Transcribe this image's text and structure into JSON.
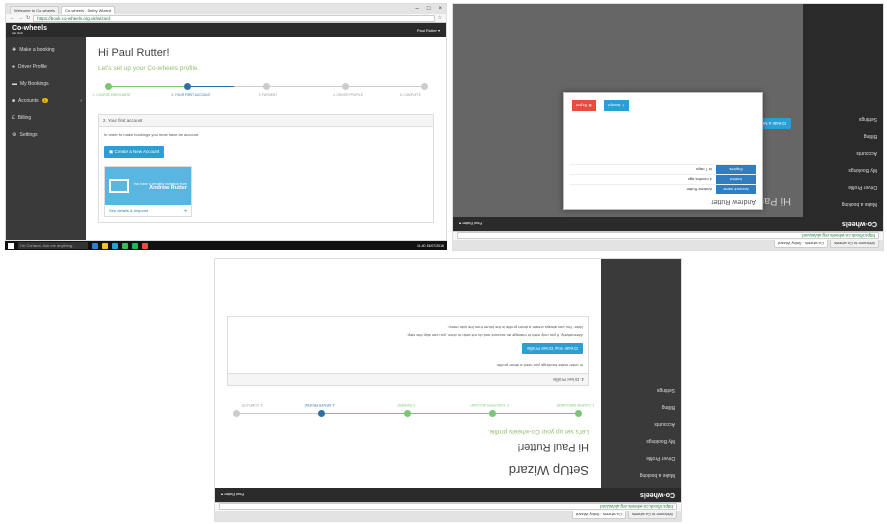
{
  "browser": {
    "tabs": [
      "Welcome to Co-wheels",
      "Co-wheels - Selby Wizard"
    ],
    "url": "https://book.co-wheels.org.uk/wizard",
    "window_controls": [
      "–",
      "□",
      "×"
    ]
  },
  "app": {
    "logo": "Co-wheels",
    "logo_sub": "car club",
    "user_menu": "Paul Rutter ▾"
  },
  "sidebar": {
    "items": [
      {
        "label": "Make a booking",
        "icon": "plus-icon"
      },
      {
        "label": "Driver Profile",
        "icon": "user-icon"
      },
      {
        "label": "My Bookings",
        "icon": "car-icon"
      },
      {
        "label": "Accounts",
        "icon": "briefcase-icon",
        "badge": "1"
      },
      {
        "label": "Billing",
        "icon": "pound-icon"
      },
      {
        "label": "Settings",
        "icon": "gear-icon"
      }
    ]
  },
  "wizard": {
    "heading": "Hi Paul Rutter!",
    "subheading": "Let's set up your Co-wheels profile.",
    "steps": [
      {
        "label": "1. COURSE ENROLMENT",
        "state": "done"
      },
      {
        "label": "2. YOUR FIRST ACCOUNT",
        "state": "active"
      },
      {
        "label": "3. PAYMENT",
        "state": "todo"
      },
      {
        "label": "4. DRIVER PROFILE",
        "state": "todo"
      },
      {
        "label": "5. COMPLETE",
        "state": "todo"
      }
    ],
    "section_title": "2. Your first account",
    "section_text": "In order to make bookings you must have an account.",
    "create_button": "Create a New Account",
    "invite_text": "You have a pending invitation from",
    "invite_name": "Andrew Rutter",
    "invite_link": "See details & respond"
  },
  "second": {
    "modal_title": "Andrew Rutter",
    "rows": [
      {
        "k": "Account name",
        "v": "Andrew Rutter"
      },
      {
        "k": "Invited",
        "v": "4 months ago"
      },
      {
        "k": "Expires",
        "v": "in 7 days"
      }
    ],
    "accept": "✓ Accept",
    "reject": "⊗ Reject",
    "create_button": "Create a New Account"
  },
  "third": {
    "title": "SetUp Wizard",
    "heading": "Hi Paul Rutter!",
    "subheading": "Let's set up your Co-wheels profile.",
    "section_title": "4. Driver Profile",
    "text": "In order make bookings you need a driver profile.",
    "button": "Create Your Driver Profile",
    "note": "Alternatively, if you only wish to manage an account and do not wish to drive, you can skip this step.",
    "note2": "Note: You can always create a driver profile in the future from the side menu."
  },
  "taskbar": {
    "search": "I'm Cortana. Ask me anything.",
    "clock": "11:40",
    "date": "15/07/2016"
  },
  "colors": {
    "green": "#7cc576",
    "blue": "#2f6fa8",
    "accent": "#2a9fd6",
    "sidebar": "#3a3a3a",
    "topbar": "#2b2b2b"
  }
}
